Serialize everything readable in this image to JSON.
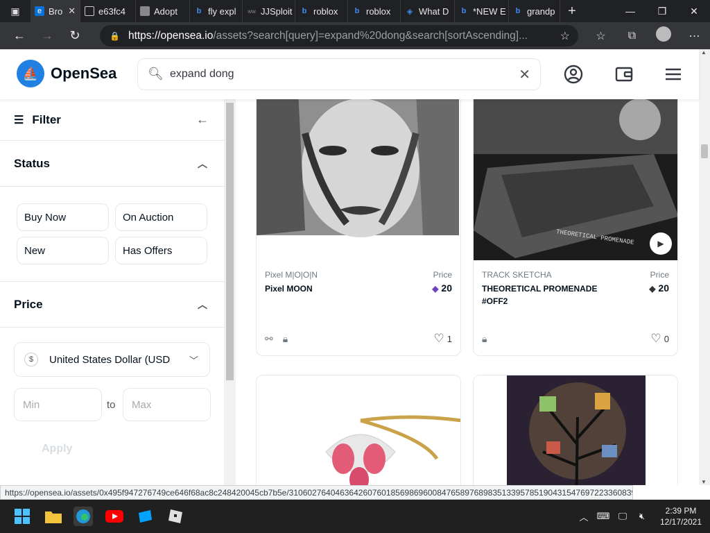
{
  "browser": {
    "tabs": [
      {
        "label": "Bro",
        "icon": "edge-icon",
        "active": true
      },
      {
        "label": "e63fc4",
        "icon": "page-icon"
      },
      {
        "label": "Adopt",
        "icon": "roblox-icon"
      },
      {
        "label": "fly expl",
        "icon": "bing-icon"
      },
      {
        "label": "JJSploit",
        "icon": "jj-icon"
      },
      {
        "label": "roblox",
        "icon": "bing-icon"
      },
      {
        "label": "roblox",
        "icon": "bing-icon"
      },
      {
        "label": "What D",
        "icon": "roblox-icon"
      },
      {
        "label": "*NEW E",
        "icon": "bing-icon"
      },
      {
        "label": "grandp",
        "icon": "bing-icon"
      }
    ],
    "url_host": "https://opensea.io",
    "url_rest": "/assets?search[query]=expand%20dong&search[sortAscending]..."
  },
  "header": {
    "brand": "OpenSea",
    "search_value": "expand dong"
  },
  "sidebar": {
    "filter_label": "Filter",
    "status_title": "Status",
    "status_options": [
      "Buy Now",
      "On Auction",
      "New",
      "Has Offers"
    ],
    "price_title": "Price",
    "currency": "United States Dollar (USD",
    "currency_symbol": "$",
    "min_placeholder": "Min",
    "max_placeholder": "Max",
    "to_label": "to",
    "apply_label": "Apply"
  },
  "cards": [
    {
      "collection": "Pixel M|O|O|N",
      "name": "Pixel MOON",
      "price_label": "Price",
      "price": "20",
      "likes": "1"
    },
    {
      "collection": "TRACK SKETCHA",
      "name": "THEORETICAL PROMENADE #OFF2",
      "price_label": "Price",
      "price": "20",
      "likes": "0",
      "image_caption": "THEORETICAL PROMENADE"
    }
  ],
  "status_url": "https://opensea.io/assets/0x495f947276749ce646f68ac8c248420045cb7b5e/31060276404636426076018569869600847658976898351339578519043154769722336083969",
  "taskbar": {
    "time": "2:39 PM",
    "date": "12/17/2021"
  },
  "colors": {
    "brand_blue": "#2081e2",
    "text": "#04111d",
    "border": "#e5e8eb"
  }
}
